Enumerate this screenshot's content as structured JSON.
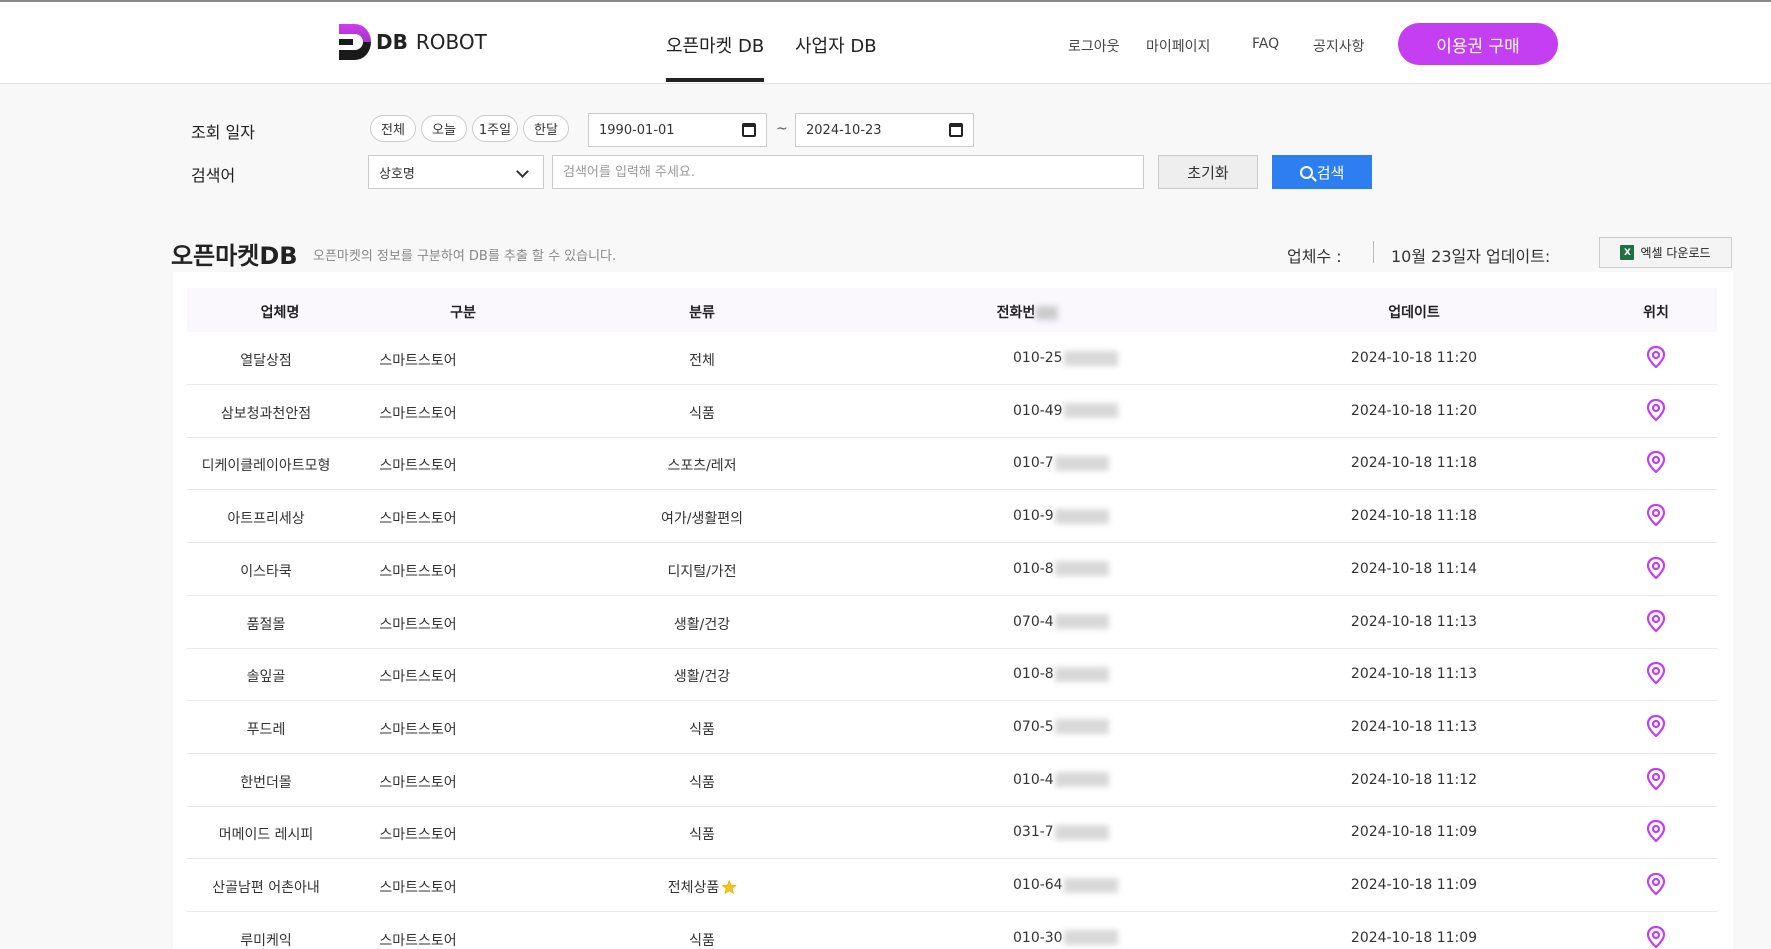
{
  "header": {
    "logo_db": "DB",
    "logo_robot": "ROBOT",
    "tabs": [
      {
        "label": "오픈마켓 DB",
        "active": true
      },
      {
        "label": "사업자 DB",
        "active": false
      }
    ],
    "menu": [
      "로그아웃",
      "마이페이지",
      "FAQ",
      "공지사항"
    ],
    "buy_button": "이용권 구매",
    "accent_color": "#c43ef2"
  },
  "filters": {
    "date_label": "조회 일자",
    "date_pills": [
      "전체",
      "오늘",
      "1주일",
      "한달"
    ],
    "date_from": "1990-01-01",
    "date_separator": "~",
    "date_to": "2024-10-23",
    "keyword_label": "검색어",
    "select_value": "상호명",
    "search_placeholder": "검색어를 입력해 주세요.",
    "reset_button": "초기화",
    "search_button": "검색"
  },
  "section": {
    "title": "오픈마켓DB",
    "description": "오픈마켓의 정보를 구분하여 DB를 추출 할 수 있습니다.",
    "count_label": "업체수 :",
    "update_label": "10월 23일자 업데이트:",
    "excel_button": "엑셀 다운로드"
  },
  "table": {
    "columns": [
      "업체명",
      "구분",
      "분류",
      "전화번",
      "업데이트",
      "위치"
    ],
    "rows": [
      {
        "name": "열달상점",
        "type": "스마트스토어",
        "category": "전체",
        "phone": "010-25",
        "updated": "2024-10-18 11:20"
      },
      {
        "name": "삼보청과천안점",
        "type": "스마트스토어",
        "category": "식품",
        "phone": "010-49",
        "updated": "2024-10-18 11:20"
      },
      {
        "name": "디케이클레이아트모형",
        "type": "스마트스토어",
        "category": "스포츠/레저",
        "phone": "010-7",
        "updated": "2024-10-18 11:18"
      },
      {
        "name": "아트프리세상",
        "type": "스마트스토어",
        "category": "여가/생활편의",
        "phone": "010-9",
        "updated": "2024-10-18 11:18"
      },
      {
        "name": "이스타쿡",
        "type": "스마트스토어",
        "category": "디지털/가전",
        "phone": "010-8",
        "updated": "2024-10-18 11:14"
      },
      {
        "name": "품절몰",
        "type": "스마트스토어",
        "category": "생활/건강",
        "phone": "070-4",
        "updated": "2024-10-18 11:13"
      },
      {
        "name": "솔잎골",
        "type": "스마트스토어",
        "category": "생활/건강",
        "phone": "010-8",
        "updated": "2024-10-18 11:13"
      },
      {
        "name": "푸드레",
        "type": "스마트스토어",
        "category": "식품",
        "phone": "070-5",
        "updated": "2024-10-18 11:13"
      },
      {
        "name": "한번더몰",
        "type": "스마트스토어",
        "category": "식품",
        "phone": "010-4",
        "updated": "2024-10-18 11:12"
      },
      {
        "name": "머메이드 레시피",
        "type": "스마트스토어",
        "category": "식품",
        "phone": "031-7",
        "updated": "2024-10-18 11:09"
      },
      {
        "name": "산골남편 어촌아내",
        "type": "스마트스토어",
        "category": "전체상품",
        "phone": "010-64",
        "updated": "2024-10-18 11:09",
        "star": true
      },
      {
        "name": "루미케익",
        "type": "스마트스토어",
        "category": "식품",
        "phone": "010-30",
        "updated": "2024-10-18 11:09"
      }
    ]
  },
  "icons": {
    "location": "map-pin-icon",
    "star": "star-icon",
    "excel": "excel-icon",
    "calendar": "calendar-icon",
    "search": "search-icon",
    "chevron": "chevron-down-icon"
  }
}
